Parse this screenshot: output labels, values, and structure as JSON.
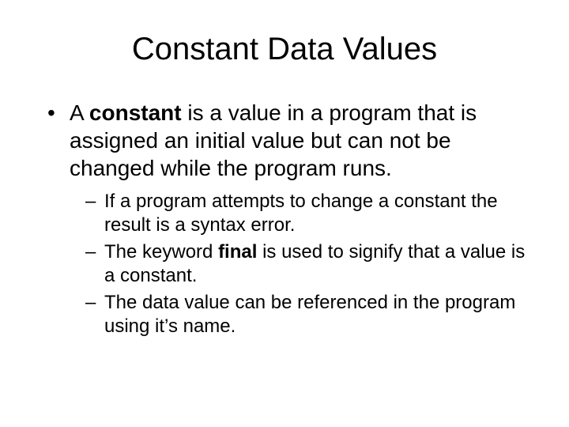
{
  "title": "Constant Data Values",
  "bullet1_pre": "A ",
  "bullet1_bold": "constant",
  "bullet1_post": " is a value in a program that is assigned an initial value but can not be changed while the program runs.",
  "sub1": "If a program attempts to change a constant the result is a syntax error.",
  "sub2_pre": "The keyword ",
  "sub2_bold": "final",
  "sub2_post": " is used to signify that a value is a constant.",
  "sub3": "The data value can be referenced in the program using it’s name."
}
